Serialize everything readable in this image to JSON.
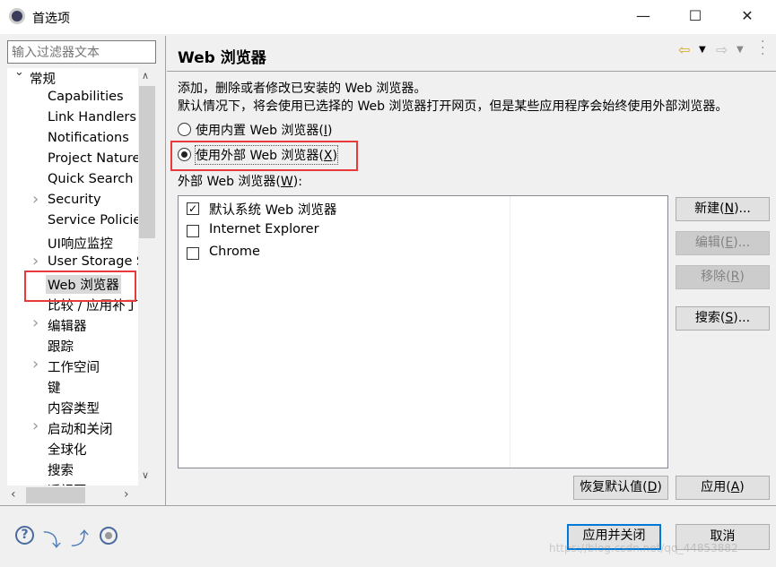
{
  "window": {
    "title": "首选项",
    "minimize": "—",
    "maximize": "☐",
    "close": "✕"
  },
  "sidebar": {
    "filter_placeholder": "输入过滤器文本",
    "items": [
      {
        "label": "常规",
        "level": 0,
        "expander": "expanded"
      },
      {
        "label": "Capabilities",
        "level": 1
      },
      {
        "label": "Link Handlers",
        "level": 1
      },
      {
        "label": "Notifications",
        "level": 1
      },
      {
        "label": "Project Natures",
        "level": 1
      },
      {
        "label": "Quick Search",
        "level": 1
      },
      {
        "label": "Security",
        "level": 1,
        "expander": "collapsed"
      },
      {
        "label": "Service Policies",
        "level": 1
      },
      {
        "label": "UI响应监控",
        "level": 1
      },
      {
        "label": "User Storage Service",
        "level": 1,
        "expander": "collapsed"
      },
      {
        "label": "Web 浏览器",
        "level": 1,
        "selected": true
      },
      {
        "label": "比较 / 应用补丁",
        "level": 1
      },
      {
        "label": "编辑器",
        "level": 1,
        "expander": "collapsed"
      },
      {
        "label": "跟踪",
        "level": 1
      },
      {
        "label": "工作空间",
        "level": 1,
        "expander": "collapsed"
      },
      {
        "label": "键",
        "level": 1
      },
      {
        "label": "内容类型",
        "level": 1
      },
      {
        "label": "启动和关闭",
        "level": 1,
        "expander": "collapsed"
      },
      {
        "label": "全球化",
        "level": 1
      },
      {
        "label": "搜索",
        "level": 1
      },
      {
        "label": "透视图",
        "level": 1
      }
    ]
  },
  "main": {
    "title": "Web 浏览器",
    "desc1": "添加，删除或者修改已安装的 Web 浏览器。",
    "desc2": "默认情况下，将会使用已选择的 Web 浏览器打开网页，但是某些应用程序会始终使用外部浏览器。",
    "radio_internal": {
      "label": "使用内置 Web 浏览器(",
      "key": "I",
      "end": ")",
      "checked": false
    },
    "radio_external": {
      "label": "使用外部 Web 浏览器(",
      "key": "X",
      "end": ")",
      "checked": true
    },
    "list_label": {
      "label": "外部 Web 浏览器(",
      "key": "W",
      "end": "):"
    },
    "browsers": [
      {
        "name": "默认系统 Web 浏览器",
        "checked": true
      },
      {
        "name": "Internet Explorer",
        "checked": false
      },
      {
        "name": "Chrome",
        "checked": false
      }
    ],
    "buttons": {
      "new": {
        "l": "新建(",
        "k": "N",
        "e": ")..."
      },
      "edit": {
        "l": "编辑(",
        "k": "E",
        "e": ")..."
      },
      "remove": {
        "l": "移除(",
        "k": "R",
        "e": ")"
      },
      "search": {
        "l": "搜索(",
        "k": "S",
        "e": ")..."
      },
      "restore": {
        "l": "恢复默认值(",
        "k": "D",
        "e": ")"
      },
      "apply": {
        "l": "应用(",
        "k": "A",
        "e": ")"
      }
    }
  },
  "footer": {
    "apply_close": "应用并关闭",
    "cancel": "取消",
    "watermark": "https://blog.csdn.net/qq_44853882"
  },
  "colors": {
    "highlight": "#e83a3a",
    "default_button": "#0078d7",
    "selected_item": "#cce8ff"
  }
}
